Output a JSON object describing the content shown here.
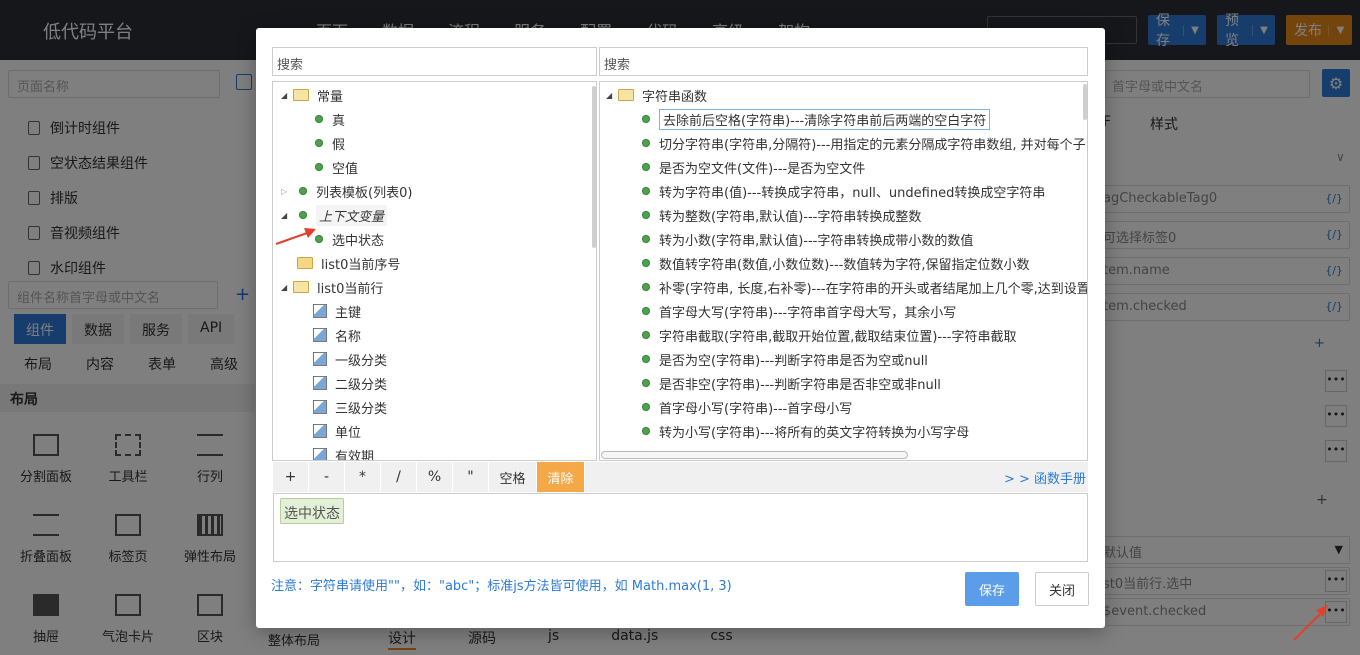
{
  "app": {
    "title": "低代码平台"
  },
  "topmenu": [
    "页面",
    "数据",
    "流程",
    "服务",
    "配置",
    "代码",
    "高级",
    "架构"
  ],
  "toolbar": {
    "save": "保存",
    "preview": "预览",
    "publish": "发布"
  },
  "left_panel": {
    "page_search_placeholder": "页面名称",
    "items": [
      "倒计时组件",
      "空状态结果组件",
      "排版",
      "音视频组件",
      "水印组件"
    ],
    "component_search_placeholder": "组件名称首字母或中文名",
    "tabs": [
      "组件",
      "数据",
      "服务",
      "API"
    ],
    "subtabs": [
      "布局",
      "内容",
      "表单",
      "高级"
    ],
    "section": "布局",
    "components": [
      "分割面板",
      "工具栏",
      "行列",
      "折叠面板",
      "标签页",
      "弹性布局",
      "抽屉",
      "气泡卡片",
      "区块",
      "整体布局"
    ]
  },
  "right_panel": {
    "search_placeholder": "首字母或中文名",
    "tabs": [
      "F",
      "样式"
    ],
    "inputs": [
      "agCheckableTag0",
      "可选择标签0",
      "tem.name",
      "tem.checked"
    ],
    "bottom_label": "默认值",
    "bottom_inputs": [
      "st0当前行.选中",
      "$event.checked"
    ],
    "icon_text": "{/}"
  },
  "bottom_tabs": [
    "设计",
    "源码",
    "js",
    "data.js",
    "css"
  ],
  "dialog": {
    "left_search_placeholder": "搜索",
    "right_search_placeholder": "搜索",
    "left_tree": [
      {
        "label": "常量"
      },
      {
        "label": "真"
      },
      {
        "label": "假"
      },
      {
        "label": "空值"
      },
      {
        "label": "列表模板(列表0)"
      },
      {
        "label": "上下文变量"
      },
      {
        "label": "选中状态"
      },
      {
        "label": "list0当前序号"
      },
      {
        "label": "list0当前行"
      },
      {
        "label": "主键"
      },
      {
        "label": "名称"
      },
      {
        "label": "一级分类"
      },
      {
        "label": "二级分类"
      },
      {
        "label": "三级分类"
      },
      {
        "label": "单位"
      },
      {
        "label": "有效期"
      }
    ],
    "right_tree_root": "字符串函数",
    "right_tree": [
      "去除前后空格(字符串)---清除字符串前后两端的空白字符",
      "切分字符串(字符串,分隔符)---用指定的元素分隔成字符串数组, 并对每个子",
      "是否为空文件(文件)---是否为空文件",
      "转为字符串(值)---转换成字符串，null、undefined转换成空字符串",
      "转为整数(字符串,默认值)---字符串转换成整数",
      "转为小数(字符串,默认值)---字符串转换成带小数的数值",
      "数值转字符串(数值,小数位数)---数值转为字符,保留指定位数小数",
      "补零(字符串, 长度,右补零)---在字符串的开头或者结尾加上几个零,达到设置",
      "首字母大写(字符串)---字符串首字母大写，其余小写",
      "字符串截取(字符串,截取开始位置,截取结束位置)---字符串截取",
      "是否为空(字符串)---判断字符串是否为空或null",
      "是否非空(字符串)---判断字符串是否非空或非null",
      "首字母小写(字符串)---首字母小写",
      "转为小写(字符串)---将所有的英文字符转换为小写字母"
    ],
    "operators": [
      "+",
      "-",
      "*",
      "/",
      "%",
      "\""
    ],
    "space_label": "空格",
    "clear_label": "清除",
    "manual_link": "> > 函数手册",
    "expression_token": "选中状态",
    "note": "注意：字符串请使用\"\"，如：\"abc\"；标准js方法皆可使用，如 Math.max(1, 3)",
    "save": "保存",
    "close": "关闭"
  }
}
